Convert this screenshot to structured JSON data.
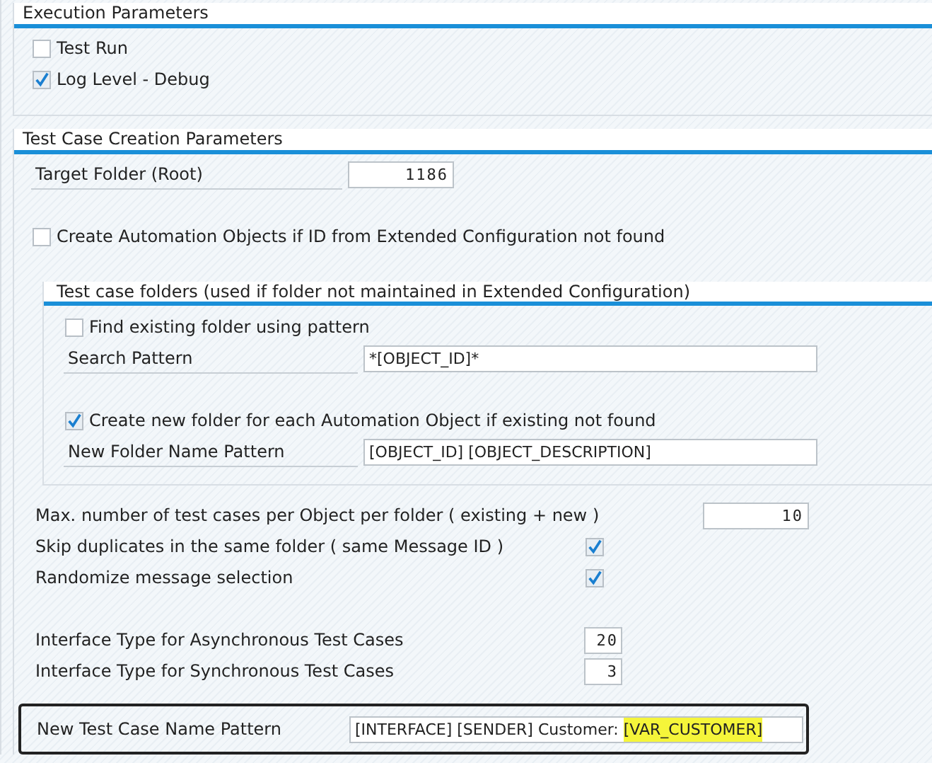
{
  "groups": [
    {
      "title": "Execution Parameters",
      "items": [
        {
          "kind": "checkbox",
          "label": "Test Run",
          "checked": false
        },
        {
          "kind": "checkbox",
          "label": "Log Level - Debug",
          "checked": true
        }
      ]
    },
    {
      "title": "Test Case Creation Parameters",
      "items": [
        {
          "kind": "number_field",
          "label": "Target Folder (Root)",
          "value": "1186"
        },
        {
          "kind": "gap"
        },
        {
          "kind": "checkbox",
          "label": "Create Automation Objects if ID from Extended Configuration not found",
          "checked": false
        },
        {
          "kind": "subgroup",
          "title": "Test case folders (used if folder not maintained in Extended Configuration)",
          "items": [
            {
              "kind": "checkbox",
              "label": "Find existing folder using pattern",
              "checked": false
            },
            {
              "kind": "text_field",
              "label": "Search Pattern",
              "value": "*[OBJECT_ID]*"
            },
            {
              "kind": "gap"
            },
            {
              "kind": "checkbox",
              "label": "Create new folder for each Automation Object if existing not found",
              "checked": true
            },
            {
              "kind": "text_field",
              "label": "New Folder Name Pattern",
              "value": "[OBJECT_ID] [OBJECT_DESCRIPTION]"
            }
          ]
        },
        {
          "kind": "count_field",
          "label": "Max. number of test cases per Object per folder ( existing + new )",
          "value": "10"
        },
        {
          "kind": "check_option",
          "label": "Skip duplicates in the same folder ( same Message ID )",
          "checked": true
        },
        {
          "kind": "check_option",
          "label": "Randomize message selection",
          "checked": true
        },
        {
          "kind": "gap"
        },
        {
          "kind": "small_field",
          "label": "Interface Type for Asynchronous Test Cases",
          "value": "20"
        },
        {
          "kind": "small_field",
          "label": "Interface Type for Synchronous Test Cases",
          "value": "3"
        },
        {
          "kind": "framed_field",
          "label": "New Test Case Name Pattern",
          "value_parts": [
            {
              "text": "[INTERFACE] [SENDER] Customer: ",
              "highlighted": false
            },
            {
              "text": "[VAR_CUSTOMER]",
              "highlighted": true
            }
          ]
        }
      ]
    }
  ]
}
